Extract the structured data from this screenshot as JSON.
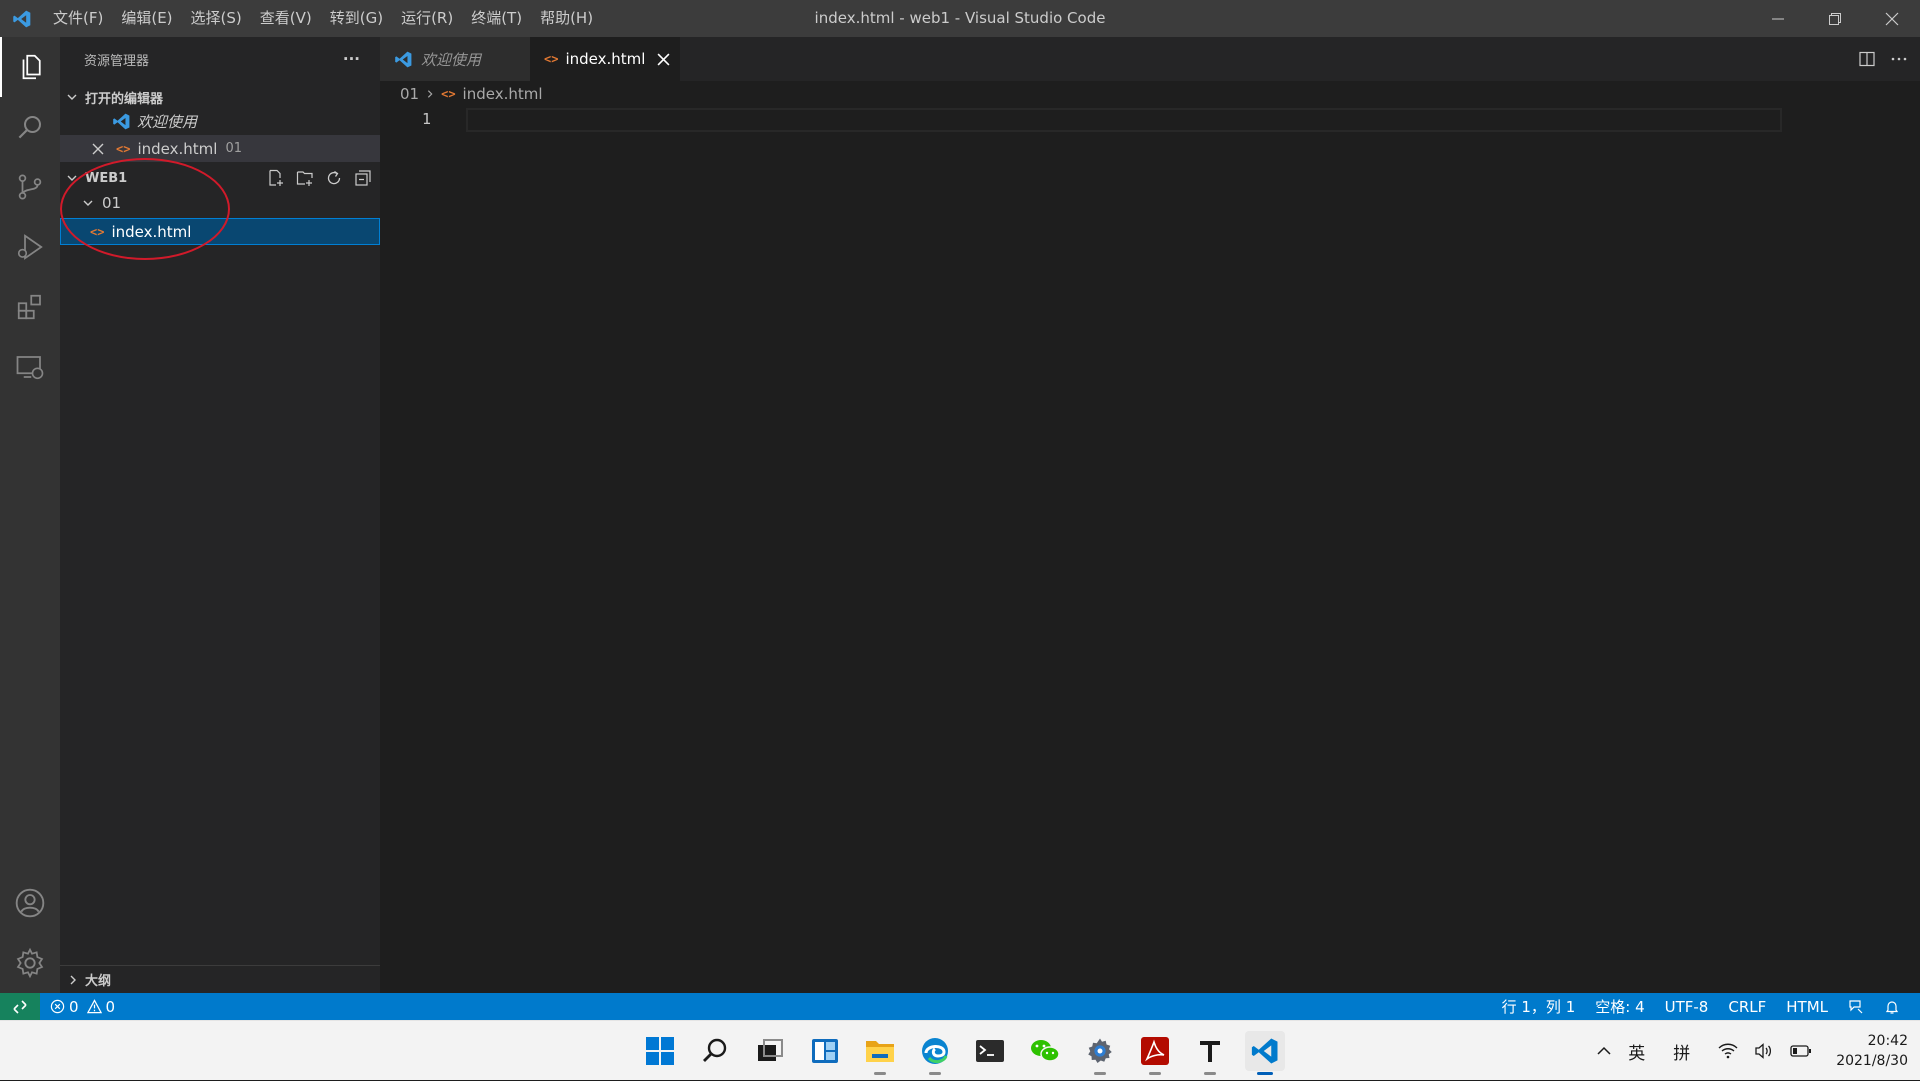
{
  "title_bar": {
    "menu": [
      "文件(F)",
      "编辑(E)",
      "选择(S)",
      "查看(V)",
      "转到(G)",
      "运行(R)",
      "终端(T)",
      "帮助(H)"
    ],
    "window_title": "index.html - web1 - Visual Studio Code"
  },
  "activity_bar": {
    "top": [
      "explorer-icon",
      "search-icon",
      "source-control-icon",
      "run-debug-icon",
      "extensions-icon",
      "remote-explorer-icon"
    ],
    "bottom": [
      "account-icon",
      "gear-icon"
    ]
  },
  "sidebar": {
    "title": "资源管理器",
    "more": "···",
    "open_editors": {
      "label": "打开的编辑器",
      "items": [
        {
          "name": "欢迎使用",
          "icon": "vscode-icon"
        },
        {
          "name": "index.html",
          "desc": "01",
          "icon": "html-icon"
        }
      ]
    },
    "workspace": {
      "label": "WEB1",
      "folder": "01",
      "file": "index.html"
    },
    "outline": "大纲"
  },
  "tabs": [
    {
      "label": "欢迎使用",
      "active": false
    },
    {
      "label": "index.html",
      "active": true
    }
  ],
  "breadcrumb": {
    "folder": "01",
    "file": "index.html"
  },
  "editor": {
    "line_number": "1"
  },
  "status_bar": {
    "errors": "0",
    "warnings": "0",
    "position": "行 1，列 1",
    "spaces": "空格: 4",
    "encoding": "UTF-8",
    "eol": "CRLF",
    "language": "HTML"
  },
  "taskbar": {
    "apps": [
      "start-icon",
      "search-icon",
      "task-view-icon",
      "widgets-icon",
      "file-explorer-icon",
      "edge-icon",
      "terminal-icon",
      "wechat-icon",
      "settings-icon",
      "acrobat-icon",
      "typora-icon",
      "vscode-icon"
    ],
    "tray": {
      "lang": "英",
      "ime": "拼",
      "time": "20:42",
      "date": "2021/8/30"
    }
  },
  "colors": {
    "accent": "#007acc",
    "selection": "#094771",
    "annotation": "#d11a2a"
  }
}
